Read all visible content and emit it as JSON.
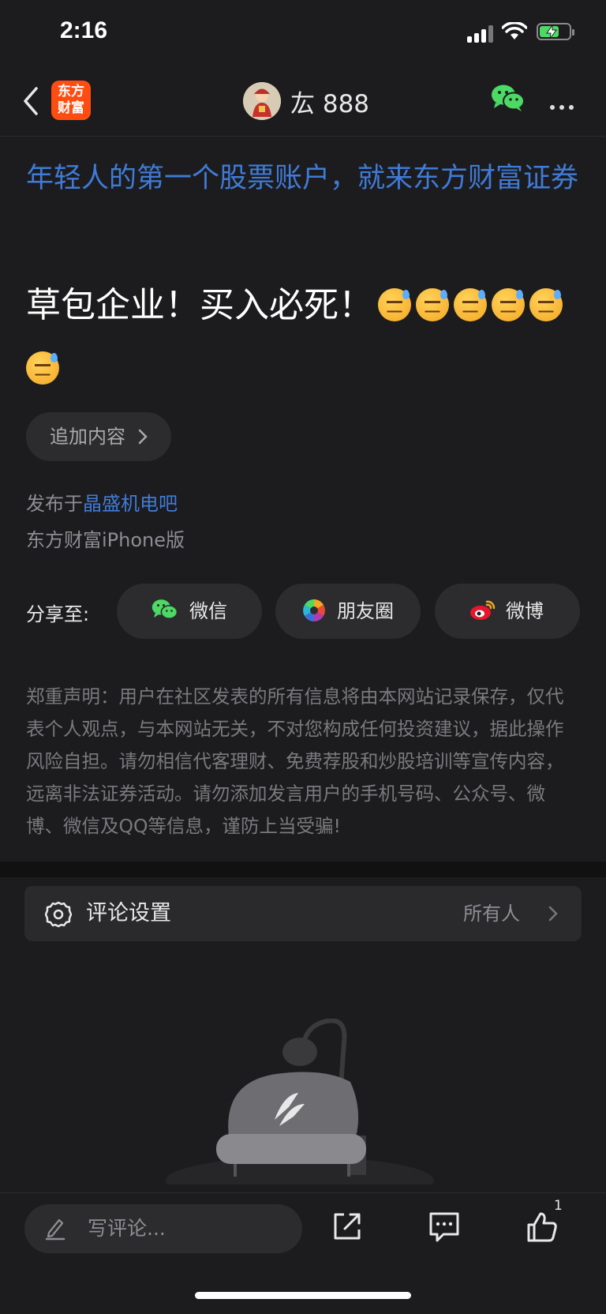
{
  "status_bar": {
    "time": "2:16"
  },
  "nav": {
    "logo_line1": "东方",
    "logo_line2": "财富",
    "username": "厷 888"
  },
  "post": {
    "ad_text": "年轻人的第一个股票账户，就来东方财富证券",
    "content": "草包企业！买入必死！",
    "emoji_count": 6,
    "append_label": "追加内容",
    "published_prefix": "发布于",
    "published_bar": "晶盛机电吧",
    "device": "东方财富iPhone版"
  },
  "share": {
    "label": "分享至:",
    "wechat": "微信",
    "moments": "朋友圈",
    "weibo": "微博"
  },
  "disclaimer": "郑重声明：用户在社区发表的所有信息将由本网站记录保存，仅代表个人观点，与本网站无关，不对您构成任何投资建议，据此操作风险自担。请勿相信代客理财、免费荐股和炒股培训等宣传内容，远离非法证券活动。请勿添加发言用户的手机号码、公众号、微博、微信及QQ等信息，谨防上当受骗!",
  "comment_settings": {
    "label": "评论设置",
    "value": "所有人"
  },
  "bottom_bar": {
    "comment_placeholder": "写评论...",
    "like_count": "1"
  },
  "colors": {
    "background": "#1c1c1e",
    "link": "#3f7bd8",
    "wechat_green": "#4cd964",
    "logo_orange": "#ff4d12"
  }
}
